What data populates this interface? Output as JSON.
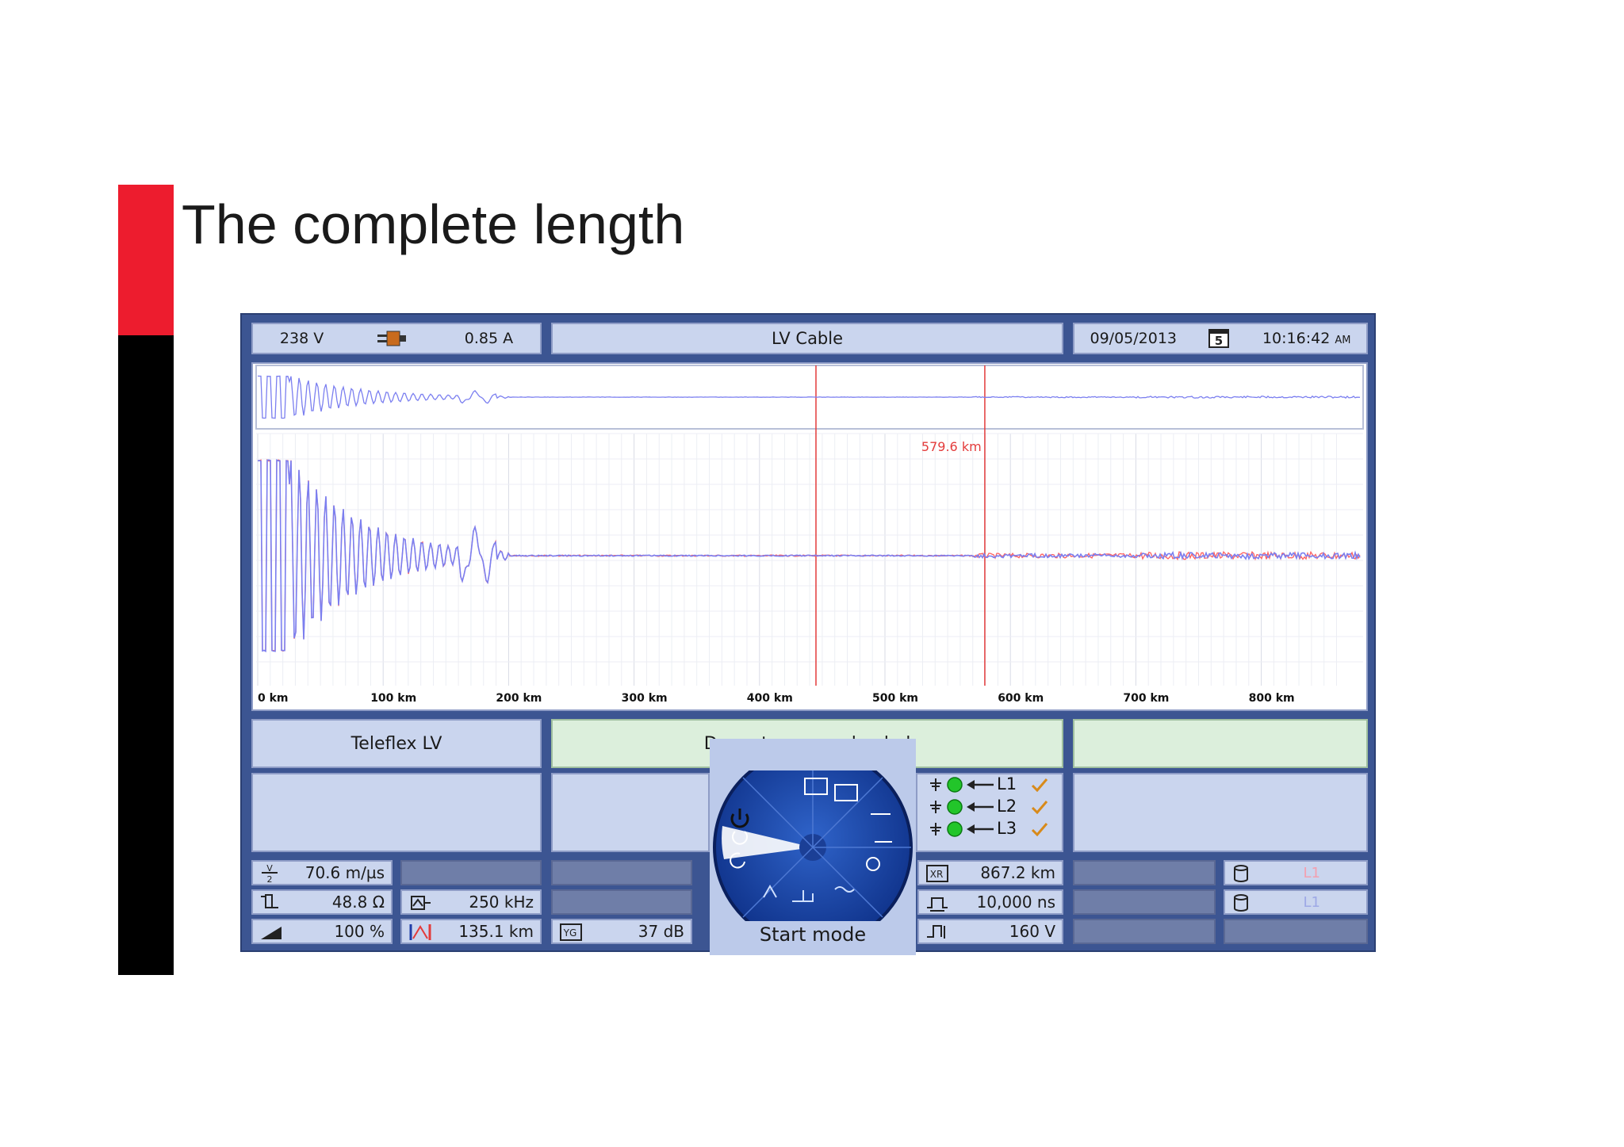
{
  "slide": {
    "title": "The complete length"
  },
  "header": {
    "voltage": "238 V",
    "current": "0.85 A",
    "cable_type": "LV Cable",
    "date": "09/05/2013",
    "time": "10:16:42",
    "ampm": "AM",
    "calendar_day": "5"
  },
  "plot": {
    "cursor_label": "579.6 km",
    "x_ticks": [
      "0 km",
      "100 km",
      "200 km",
      "300 km",
      "400 km",
      "500 km",
      "600 km",
      "700 km",
      "800 km"
    ]
  },
  "status": {
    "method": "Teleflex LV",
    "message": "Demo trace was loaded"
  },
  "phases": [
    {
      "label": "L1"
    },
    {
      "label": "L2"
    },
    {
      "label": "L3"
    }
  ],
  "dial": {
    "label": "Start mode"
  },
  "params": {
    "velocity": "70.6 m/µs",
    "impedance": "48.8 Ω",
    "percent": "100 %",
    "frequency": "250 kHz",
    "marker_distance": "135.1 km",
    "gain": "37 dB",
    "range": "867.2 km",
    "pulse_width": "10,000 ns",
    "pulse_voltage": "160 V",
    "memory_1": "L1",
    "memory_2": "L1"
  },
  "colors": {
    "device_frame": "#3c5592",
    "panel": "#cad5ee",
    "panel_dark": "#6f7ea8",
    "status_green": "#dcefdc",
    "trace_blue": "#7b7ff0",
    "trace_red": "#ff6060",
    "cursor_red": "#e33b3b"
  }
}
